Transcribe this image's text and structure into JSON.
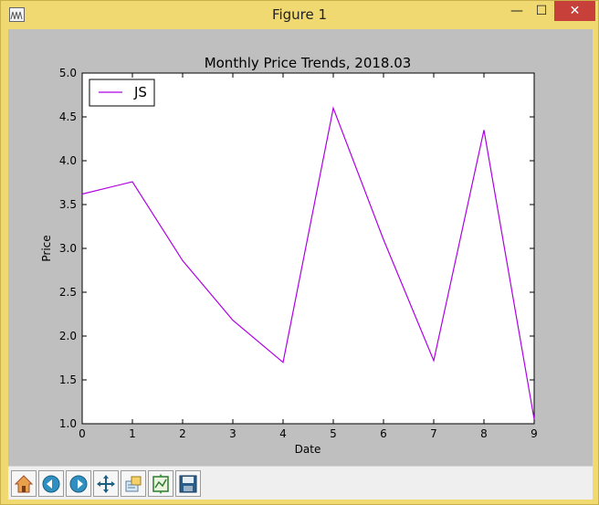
{
  "window": {
    "title": "Figure 1",
    "minimize_glyph": "—",
    "maximize_glyph": "☐",
    "close_glyph": "✕"
  },
  "toolbar": {
    "buttons": [
      "home-icon",
      "back-icon",
      "forward-icon",
      "pan-icon",
      "zoom-icon",
      "subplots-icon",
      "save-icon"
    ]
  },
  "colors": {
    "series": "#b000e6",
    "window_frame": "#f0d970",
    "figure_bg": "#bfbfbf"
  },
  "chart_data": {
    "type": "line",
    "title": "Monthly Price Trends, 2018.03",
    "xlabel": "Date",
    "ylabel": "Price",
    "xlim": [
      0,
      9
    ],
    "ylim": [
      1.0,
      5.0
    ],
    "xticks": [
      "0",
      "1",
      "2",
      "3",
      "4",
      "5",
      "6",
      "7",
      "8",
      "9"
    ],
    "yticks": [
      "1.0",
      "1.5",
      "2.0",
      "2.5",
      "3.0",
      "3.5",
      "4.0",
      "4.5",
      "5.0"
    ],
    "legend_position": "top-left",
    "grid": false,
    "series": [
      {
        "name": "JS",
        "x": [
          0,
          1,
          2,
          3,
          4,
          5,
          6,
          7,
          8,
          9
        ],
        "values": [
          3.62,
          3.76,
          2.86,
          2.18,
          1.7,
          4.6,
          3.1,
          1.72,
          4.35,
          1.05
        ]
      }
    ]
  }
}
